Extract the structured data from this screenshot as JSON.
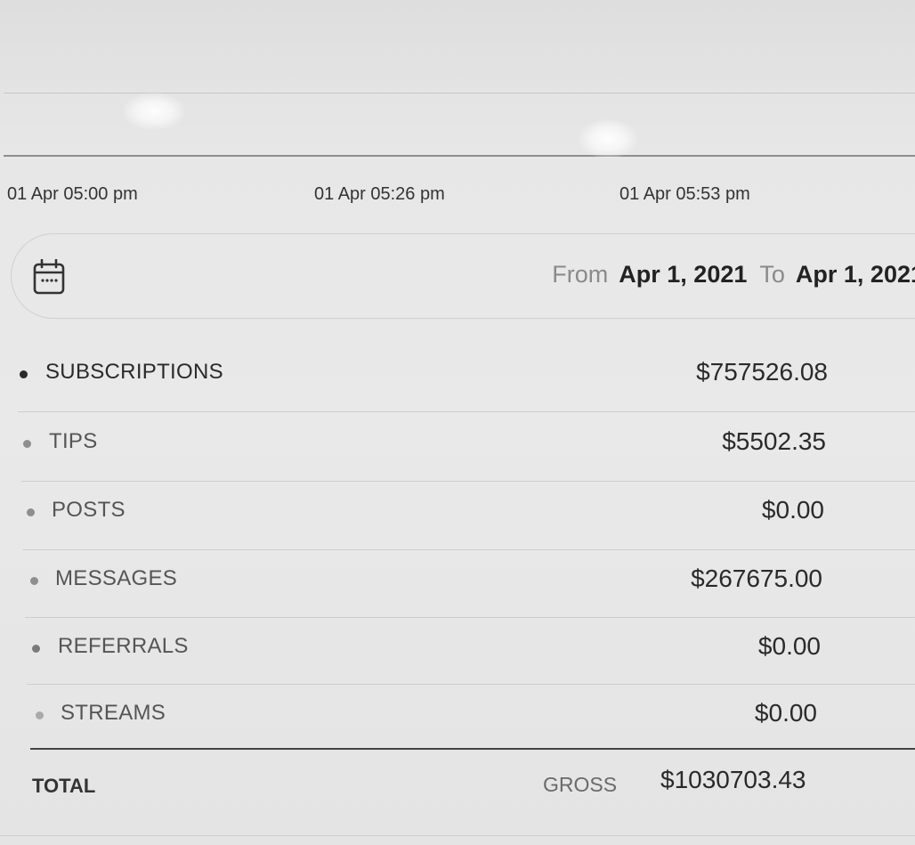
{
  "timeline": {
    "ticks": [
      "01 Apr 05:00 pm",
      "01 Apr 05:26 pm",
      "01 Apr 05:53 pm"
    ]
  },
  "date_range": {
    "from_label": "From",
    "from_value": "Apr 1, 2021",
    "to_label": "To",
    "to_value": "Apr 1, 2021",
    "icon": "calendar-icon"
  },
  "earnings": {
    "rows": [
      {
        "label": "SUBSCRIPTIONS",
        "amount": "$757526.08"
      },
      {
        "label": "TIPS",
        "amount": "$5502.35"
      },
      {
        "label": "POSTS",
        "amount": "$0.00"
      },
      {
        "label": "MESSAGES",
        "amount": "$267675.00"
      },
      {
        "label": "REFERRALS",
        "amount": "$0.00"
      },
      {
        "label": "STREAMS",
        "amount": "$0.00"
      }
    ],
    "total_label": "TOTAL",
    "gross_label": "GROSS",
    "gross_amount": "$1030703.43"
  },
  "colors": {
    "active_dot": "#2a2a2a",
    "inactive_dot": "#8e8e8e",
    "active_text": "#2a2a2a",
    "inactive_text": "#555555"
  }
}
